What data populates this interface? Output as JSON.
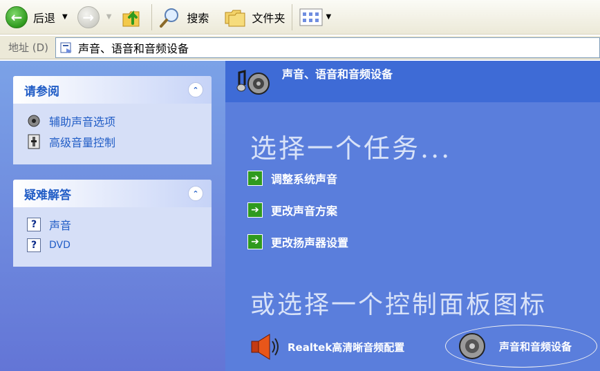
{
  "toolbar": {
    "back_label": "后退",
    "search_label": "搜索",
    "folders_label": "文件夹",
    "icons": [
      "back-arrow-icon",
      "forward-arrow-icon",
      "up-folder-icon",
      "search-icon",
      "folders-icon",
      "views-icon"
    ]
  },
  "address": {
    "label": "地址 (D)",
    "value": "声音、语音和音频设备"
  },
  "see_also": {
    "title": "请参阅",
    "items": [
      {
        "label": "辅助声音选项",
        "icon": "speaker-icon"
      },
      {
        "label": "高级音量控制",
        "icon": "volume-control-icon"
      }
    ]
  },
  "troubleshoot": {
    "title": "疑难解答",
    "items": [
      {
        "label": "声音",
        "icon": "help-icon"
      },
      {
        "label": "DVD",
        "icon": "help-icon"
      }
    ]
  },
  "content": {
    "header_title": "声音、语音和音频设备",
    "pick_task": "选择一个任务...",
    "tasks": [
      "调整系统声音",
      "更改声音方案",
      "更改扬声器设置"
    ],
    "pick_icon": "或选择一个控制面板图标",
    "cp_items": [
      {
        "label": "Realtek高清晰音频配置",
        "icon": "realtek-speaker-icon"
      },
      {
        "label": "声音和音频设备",
        "icon": "speaker-icon"
      }
    ]
  },
  "colors": {
    "left_pane": "#6f8de0",
    "content_bg": "#5a7edc",
    "header_bg": "#3e6bd6",
    "panel_title": "#215dc6",
    "task_arrow": "#2f9a1e"
  }
}
